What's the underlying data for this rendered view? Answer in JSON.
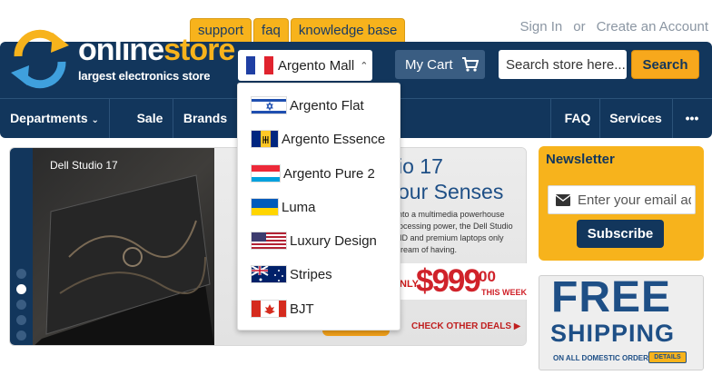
{
  "top_tabs": [
    "support",
    "faq",
    "knowledge base"
  ],
  "account": {
    "sign_in": "Sign In",
    "or": "or",
    "create": "Create an Account"
  },
  "logo": {
    "name_part1": "online",
    "name_part2": "store",
    "tagline": "largest electronics store"
  },
  "store_switcher": {
    "current": "Argento Mall",
    "current_flag": "fr-flag-icon"
  },
  "cart": {
    "label": "My Cart",
    "icon": "cart-icon"
  },
  "search": {
    "placeholder": "Search store here...",
    "button": "Search"
  },
  "nav": {
    "departments": "Departments",
    "sale": "Sale",
    "brands": "Brands",
    "faq": "FAQ",
    "services": "Services",
    "more": "•••"
  },
  "store_options": [
    {
      "label": "Argento Flat",
      "flag": "il-flag-icon"
    },
    {
      "label": "Argento Essence",
      "flag": "bb-flag-icon"
    },
    {
      "label": "Argento Pure 2",
      "flag": "lu-flag-icon"
    },
    {
      "label": "Luma",
      "flag": "ua-flag-icon"
    },
    {
      "label": "Luxury Design",
      "flag": "us-flag-icon"
    },
    {
      "label": "Stripes",
      "flag": "au-flag-icon"
    },
    {
      "label": "BJT",
      "flag": "ca-flag-icon"
    }
  ],
  "slider": {
    "title": "Dell Studio 17",
    "headline1": "io 17",
    "headline2": "our Senses",
    "description": "into a multimedia powerhouse rocessing power, the Dell Studio HD and premium laptops only dream of having.",
    "price_prefix": "NLY",
    "price": "$999",
    "price_cents": "00",
    "price_suffix": "THIS WEEK",
    "cta": "CHECK OTHER DEALS ▶",
    "dots": 5,
    "active_dot": 2
  },
  "newsletter": {
    "title": "Newsletter",
    "placeholder": "Enter your email ad",
    "button": "Subscribe"
  },
  "shipping_banner": {
    "line1": "FREE",
    "line2": "SHIPPING",
    "note": "ON ALL DOMESTIC ORDERS",
    "details": "DETAILS"
  },
  "colors": {
    "navy": "#12365c",
    "orange": "#f7b31c",
    "accent_blue": "#1e4f86",
    "price_red": "#d0222a"
  }
}
